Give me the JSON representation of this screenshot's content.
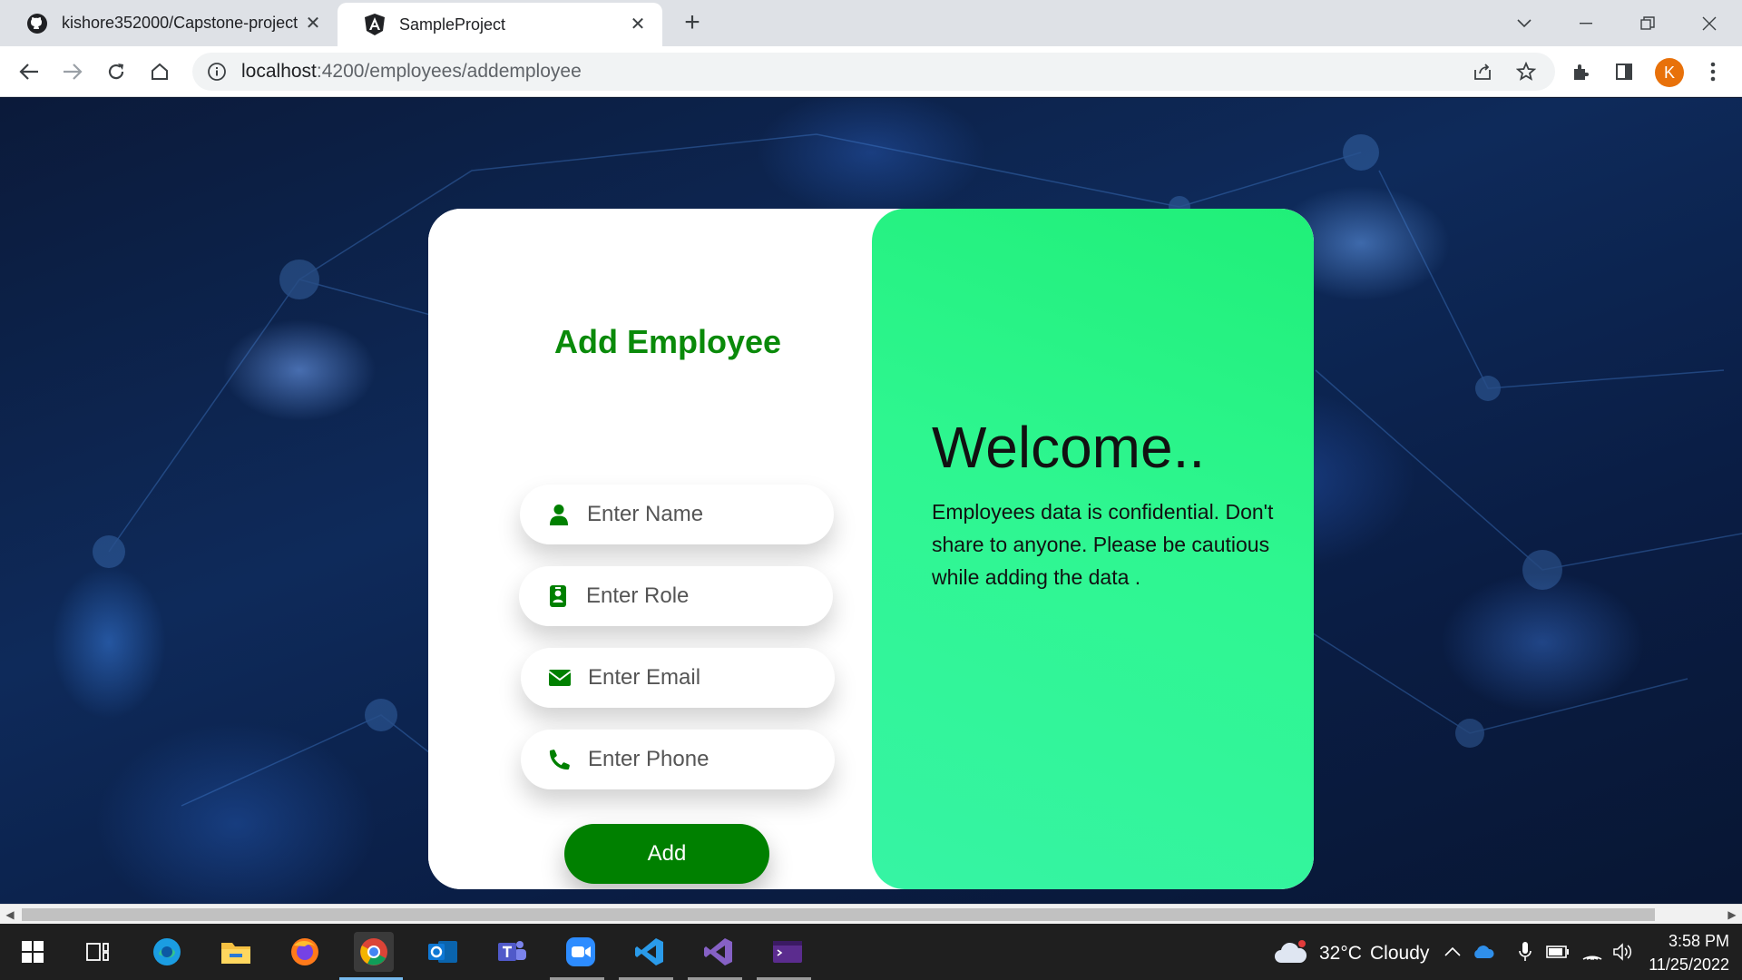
{
  "browser": {
    "tabs": [
      {
        "title": "kishore352000/Capstone-project",
        "icon": "github-icon",
        "active": false
      },
      {
        "title": "SampleProject",
        "icon": "angular-icon",
        "active": true
      }
    ],
    "url_host": "localhost",
    "url_path": ":4200/employees/addemployee",
    "profile_initial": "K"
  },
  "form": {
    "title": "Add Employee",
    "fields": {
      "name_placeholder": "Enter Name",
      "role_placeholder": "Enter Role",
      "email_placeholder": "Enter Email",
      "phone_placeholder": "Enter Phone"
    },
    "submit_label": "Add"
  },
  "welcome": {
    "title": "Welcome..",
    "message": "Employees data is confidential. Don't share to anyone. Please be cautious while adding the data ."
  },
  "taskbar": {
    "weather_temp": "32°C",
    "weather_desc": "Cloudy",
    "time": "3:58 PM",
    "date": "11/25/2022"
  },
  "colors": {
    "accent_green": "#008000",
    "title_green": "#0a8a0a",
    "panel_gradient_top": "#20ef78",
    "panel_gradient_bottom": "#36f4a4"
  }
}
